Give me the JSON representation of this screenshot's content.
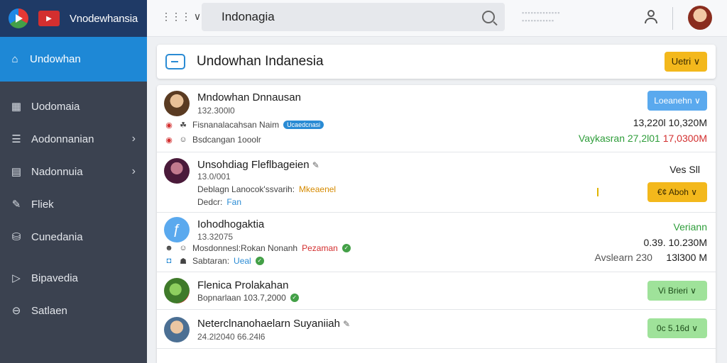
{
  "brand": {
    "title": "Vnodewhansia"
  },
  "sidebar": {
    "active": {
      "label": "Undowhan",
      "icon": "home-icon"
    },
    "items": [
      {
        "label": "Uodomaia",
        "icon": "building-icon",
        "chevron": false
      },
      {
        "label": "Aodonnanian",
        "icon": "list-icon",
        "chevron": true
      },
      {
        "label": "Nadonnuia",
        "icon": "card-icon",
        "chevron": true
      },
      {
        "label": "Fliek",
        "icon": "pen-icon",
        "chevron": false
      },
      {
        "label": "Cunedania",
        "icon": "bag-icon",
        "chevron": false
      },
      {
        "label": "Bipavedia",
        "icon": "play-icon",
        "chevron": false
      },
      {
        "label": "Satlaen",
        "icon": "disk-icon",
        "chevron": false
      }
    ]
  },
  "search": {
    "value": "Indonagia"
  },
  "header": {
    "title": "Undowhan Indanesia",
    "button_label": "Uetri ∨"
  },
  "rows": [
    {
      "title": "Mndowhan Dnnausan",
      "sub": "132.300l0",
      "line1_text": "Fisnanalacahsan Naim",
      "line1_badge": "Ucaedcnasi",
      "line2_text": "Bsdcangan 1ooolr",
      "button_label": "Loeanehn ∨",
      "value_top": "13,220l 10,320M",
      "value_green": "Vaykasran 27,2l01",
      "value_red": "17,0300M"
    },
    {
      "title": "Unsohdiag Fleflbageien",
      "sub": "13.0/001",
      "line1_text": "Deblagn Lanocok'ssvarih:",
      "line1_tag": "Mkeaenel",
      "line2_label": "Dedcr:",
      "line2_value": "Fan",
      "value_top": "Ves Sll",
      "button_label": "€¢ Aboh ∨"
    },
    {
      "title": "Iohodhogaktia",
      "sub": "13.32075",
      "line1_text": "Mosdonnesl:Rokan Nonanh",
      "line1_tag": "Pezaman",
      "line2_label": "Sabtaran:",
      "line2_value": "Ueal",
      "value_green": "Veriann",
      "value_top": "0.39. 10.230M",
      "value_left": "Avslearn 230",
      "value_right": "13l300 M"
    },
    {
      "title": "Flenica Prolakahan",
      "sub": "Bopnarlaan 103.7,2000",
      "button_label": "Vi Brieri ∨"
    },
    {
      "title": "Neterclnanohaelarn Suyaniiah",
      "sub": "24.2l2040 66.24l6",
      "button_label": "0c 5.16d ∨"
    }
  ]
}
